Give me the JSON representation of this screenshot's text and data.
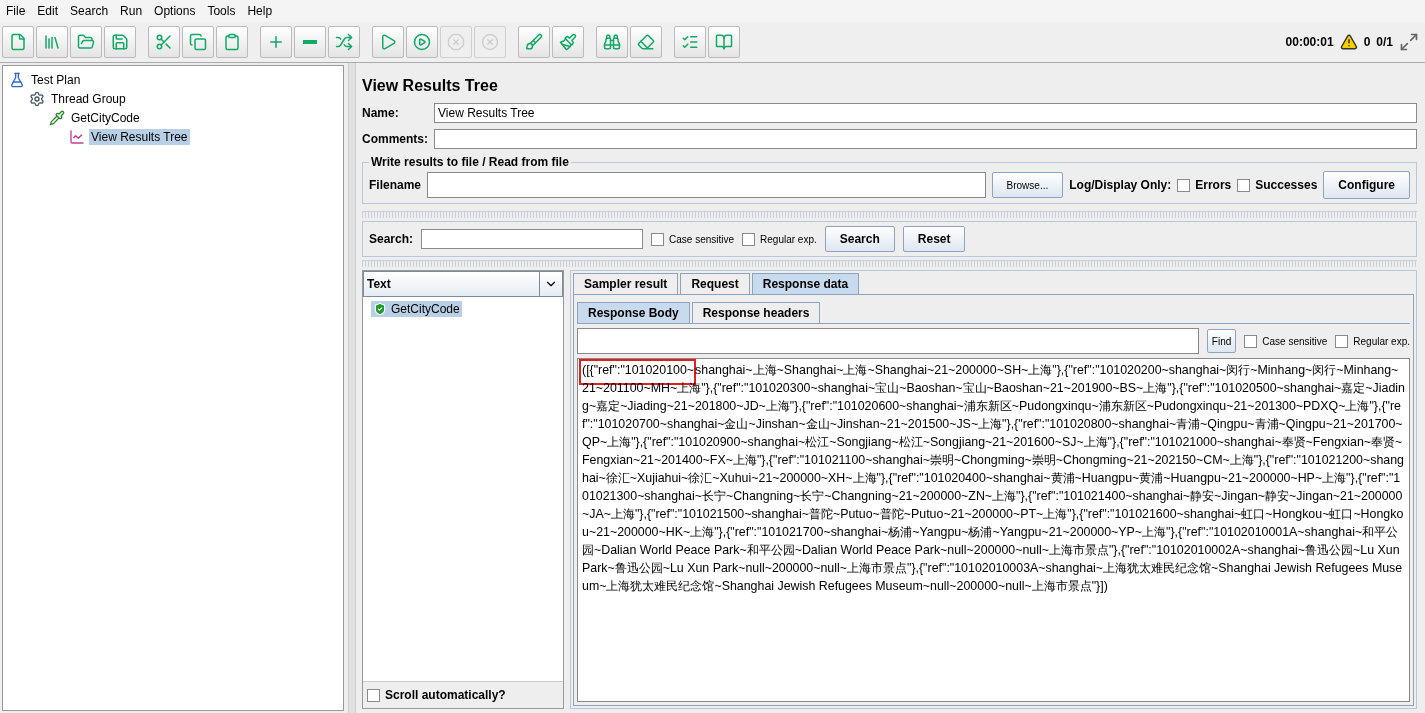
{
  "menu": [
    {
      "label": "File"
    },
    {
      "label": "Edit"
    },
    {
      "label": "Search"
    },
    {
      "label": "Run"
    },
    {
      "label": "Options"
    },
    {
      "label": "Tools"
    },
    {
      "label": "Help"
    }
  ],
  "toolbar": {
    "groups": [
      [
        {
          "disabled": false
        },
        {
          "disabled": false
        },
        {
          "disabled": false
        },
        {
          "disabled": false
        }
      ],
      [
        {
          "disabled": false
        },
        {
          "disabled": false
        },
        {
          "disabled": false
        }
      ],
      [
        {
          "disabled": false
        },
        {
          "disabled": false
        },
        {
          "disabled": false
        }
      ],
      [
        {
          "disabled": false
        },
        {
          "disabled": false
        },
        {
          "disabled": true
        },
        {
          "disabled": true
        }
      ],
      [
        {
          "disabled": false
        },
        {
          "disabled": false
        }
      ],
      [
        {
          "disabled": false
        },
        {
          "disabled": false
        }
      ],
      [
        {
          "disabled": false
        },
        {
          "disabled": false
        }
      ]
    ],
    "timer": "00:00:01",
    "warnings": "0",
    "threads": "0/1"
  },
  "tree": [
    {
      "label": "Test Plan",
      "kind": "plan",
      "selected": false,
      "children": [
        {
          "label": "Thread Group",
          "kind": "threads",
          "selected": false,
          "children": [
            {
              "label": "GetCityCode",
              "kind": "sampler",
              "selected": false,
              "children": [
                {
                  "label": "View Results Tree",
                  "kind": "listener",
                  "selected": true
                }
              ]
            }
          ]
        }
      ]
    }
  ],
  "panel": {
    "title": "View Results Tree",
    "name_label": "Name:",
    "name_value": "View Results Tree",
    "comments_label": "Comments:",
    "file_group": {
      "title": "Write results to file / Read from file",
      "filename_label": "Filename",
      "browse": "Browse...",
      "log_label": "Log/Display Only:",
      "options": [
        {
          "label": "Errors",
          "checked": false
        },
        {
          "label": "Successes",
          "checked": false
        }
      ],
      "configure": "Configure"
    },
    "search": {
      "label": "Search:",
      "options": [
        {
          "label": "Case sensitive",
          "checked": false
        },
        {
          "label": "Regular exp.",
          "checked": false
        }
      ],
      "buttons": [
        "Search",
        "Reset"
      ]
    },
    "results": {
      "renderer": "Text",
      "items": [
        {
          "label": "GetCityCode",
          "selected": true
        }
      ],
      "scroll_label": "Scroll automatically?",
      "scroll_checked": false
    },
    "tabs": [
      {
        "label": "Sampler result",
        "selected": false
      },
      {
        "label": "Request",
        "selected": false
      },
      {
        "label": "Response data",
        "selected": true
      }
    ],
    "subtabs": [
      {
        "label": "Response Body",
        "selected": true
      },
      {
        "label": "Response headers",
        "selected": false
      }
    ],
    "find": {
      "button": "Find",
      "options": [
        {
          "label": "Case sensitive",
          "checked": false
        },
        {
          "label": "Regular exp.",
          "checked": false
        }
      ]
    },
    "response_highlighted": "([{\"ref\":\"101020100~",
    "response": "shanghai~上海~Shanghai~上海~Shanghai~21~200000~SH~上海\"},{\"ref\":\"101020200~shanghai~闵行~Minhang~闵行~Minhang~21~201100~MH~上海\"},{\"ref\":\"101020300~shanghai~宝山~Baoshan~宝山~Baoshan~21~201900~BS~上海\"},{\"ref\":\"101020500~shanghai~嘉定~Jiading~嘉定~Jiading~21~201800~JD~上海\"},{\"ref\":\"101020600~shanghai~浦东新区~Pudongxinqu~浦东新区~Pudongxinqu~21~201300~PDXQ~上海\"},{\"ref\":\"101020700~shanghai~金山~Jinshan~金山~Jinshan~21~201500~JS~上海\"},{\"ref\":\"101020800~shanghai~青浦~Qingpu~青浦~Qingpu~21~201700~QP~上海\"},{\"ref\":\"101020900~shanghai~松江~Songjiang~松江~Songjiang~21~201600~SJ~上海\"},{\"ref\":\"101021000~shanghai~奉贤~Fengxian~奉贤~Fengxian~21~201400~FX~上海\"},{\"ref\":\"101021100~shanghai~崇明~Chongming~崇明~Chongming~21~202150~CM~上海\"},{\"ref\":\"101021200~shanghai~徐汇~Xujiahui~徐汇~Xuhui~21~200000~XH~上海\"},{\"ref\":\"101020400~shanghai~黄浦~Huangpu~黄浦~Huangpu~21~200000~HP~上海\"},{\"ref\":\"101021300~shanghai~长宁~Changning~长宁~Changning~21~200000~ZN~上海\"},{\"ref\":\"101021400~shanghai~静安~Jingan~静安~Jingan~21~200000~JA~上海\"},{\"ref\":\"101021500~shanghai~普陀~Putuo~普陀~Putuo~21~200000~PT~上海\"},{\"ref\":\"101021600~shanghai~虹口~Hongkou~虹口~Hongkou~21~200000~HK~上海\"},{\"ref\":\"101021700~shanghai~杨浦~Yangpu~杨浦~Yangpu~21~200000~YP~上海\"},{\"ref\":\"10102010001A~shanghai~和平公园~Dalian World Peace Park~和平公园~Dalian World Peace Park~null~200000~null~上海市景点\"},{\"ref\":\"10102010002A~shanghai~鲁迅公园~Lu Xun Park~鲁迅公园~Lu Xun Park~null~200000~null~上海市景点\"},{\"ref\":\"10102010003A~shanghai~上海犹太难民纪念馆~Shanghai Jewish Refugees Museum~上海犹太难民纪念馆~Shanghai Jewish Refugees Museum~null~200000~null~上海市景点\"}])"
  }
}
